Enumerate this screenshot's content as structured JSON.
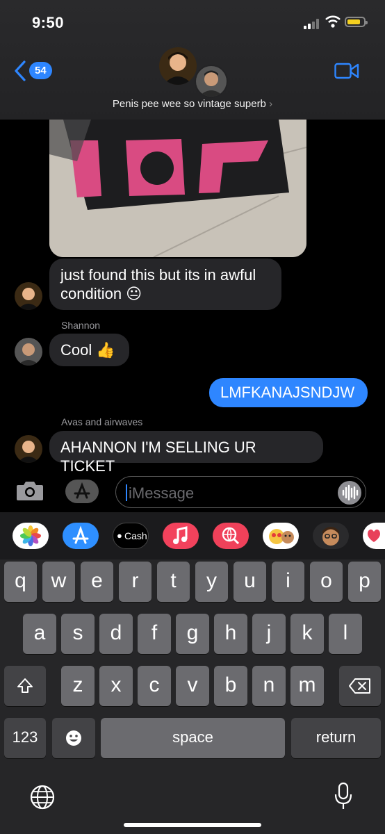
{
  "status": {
    "time": "9:50"
  },
  "header": {
    "back_count": "54",
    "group_name": "Penis pee wee so vintage superb"
  },
  "messages": {
    "m1": "just found this but its in awful condition 😐",
    "s2": "Shannon",
    "m2": "Cool 👍",
    "m3": "LMFKANAJSNDJW",
    "s4": "Avas and airwaves",
    "m4": "AHANNON I'M SELLING UR TICKET"
  },
  "compose": {
    "placeholder": "iMessage"
  },
  "app_strip": {
    "cash_label": "Cash"
  },
  "keyboard": {
    "row1": [
      "q",
      "w",
      "e",
      "r",
      "t",
      "y",
      "u",
      "i",
      "o",
      "p"
    ],
    "row2": [
      "a",
      "s",
      "d",
      "f",
      "g",
      "h",
      "j",
      "k",
      "l"
    ],
    "row3": [
      "z",
      "x",
      "c",
      "v",
      "b",
      "n",
      "m"
    ],
    "numbers": "123",
    "space": "space",
    "return": "return"
  },
  "colors": {
    "accent": "#2e86ff",
    "incoming": "#262629",
    "battery": "#f4d020"
  }
}
